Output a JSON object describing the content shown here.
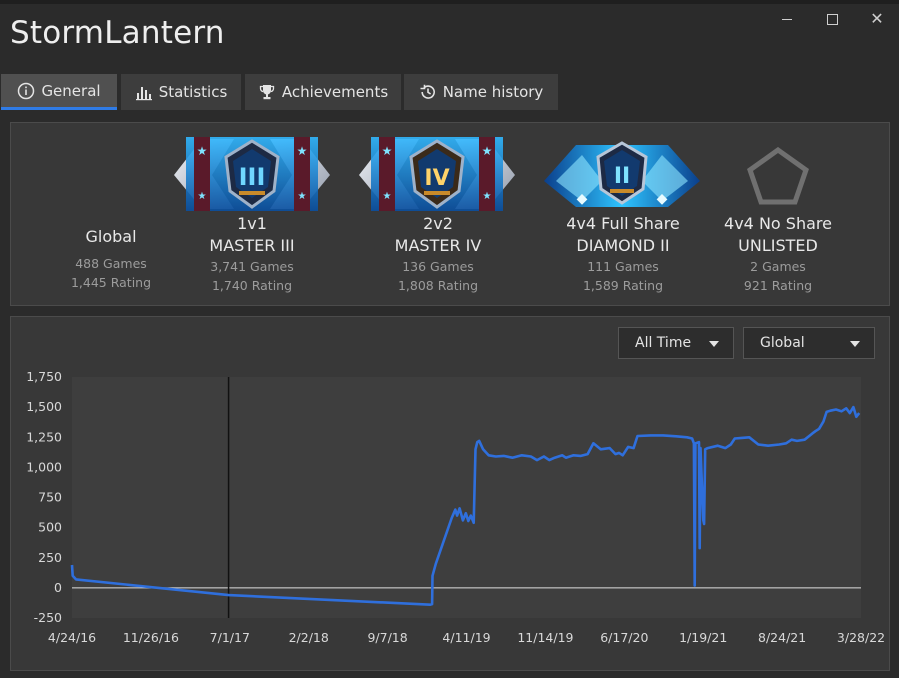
{
  "window": {
    "title": "StormLantern"
  },
  "tabs": [
    {
      "label": "General",
      "icon": "info-icon",
      "active": true
    },
    {
      "label": "Statistics",
      "icon": "bar-chart-icon",
      "active": false
    },
    {
      "label": "Achievements",
      "icon": "trophy-icon",
      "active": false
    },
    {
      "label": "Name history",
      "icon": "history-icon",
      "active": false
    }
  ],
  "ranks": [
    {
      "mode": "Global",
      "tier": "",
      "games": "488 Games",
      "rating": "1,445 Rating",
      "badge": "none"
    },
    {
      "mode": "1v1",
      "tier": "MASTER III",
      "games": "3,741 Games",
      "rating": "1,740 Rating",
      "badge": "master-badge-icon",
      "numeral": "III"
    },
    {
      "mode": "2v2",
      "tier": "MASTER IV",
      "games": "136 Games",
      "rating": "1,808 Rating",
      "badge": "master-badge-icon",
      "numeral": "IV"
    },
    {
      "mode": "4v4 Full Share",
      "tier": "DIAMOND II",
      "games": "111 Games",
      "rating": "1,589 Rating",
      "badge": "diamond-badge-icon",
      "numeral": "II"
    },
    {
      "mode": "4v4 No Share",
      "tier": "UNLISTED",
      "games": "2 Games",
      "rating": "921 Rating",
      "badge": "unlisted-badge-icon"
    }
  ],
  "filters": {
    "time_range": "All Time",
    "leaderboard": "Global"
  },
  "colors": {
    "accent": "#2f7be6",
    "series": "#2f6fdc",
    "background": "#2b2b2b",
    "plot_area": "#383838"
  },
  "chart_data": {
    "type": "line",
    "ylim": [
      -250,
      1750
    ],
    "yticks": [
      "1,750",
      "1,500",
      "1,250",
      "1,000",
      "750",
      "500",
      "250",
      "0",
      "-250"
    ],
    "xticks": [
      "4/24/16",
      "11/26/16",
      "7/1/17",
      "2/2/18",
      "9/7/18",
      "4/11/19",
      "11/14/19",
      "6/17/20",
      "1/19/21",
      "8/24/21",
      "3/28/22"
    ],
    "xlim": [
      "2016-04-24",
      "2022-04-15"
    ],
    "zero_line": true,
    "marker_date": "2017-07-01",
    "series": [
      {
        "points": [
          [
            "2016-04-24",
            190
          ],
          [
            "2016-04-26",
            100
          ],
          [
            "2016-05-05",
            70
          ],
          [
            "2017-07-01",
            -60
          ],
          [
            "2019-01-10",
            -140
          ],
          [
            "2019-01-15",
            -135
          ],
          [
            "2019-01-16",
            100
          ],
          [
            "2019-01-25",
            200
          ],
          [
            "2019-03-10",
            580
          ],
          [
            "2019-03-20",
            650
          ],
          [
            "2019-03-25",
            600
          ],
          [
            "2019-04-01",
            660
          ],
          [
            "2019-04-10",
            560
          ],
          [
            "2019-04-18",
            620
          ],
          [
            "2019-04-25",
            555
          ],
          [
            "2019-05-02",
            600
          ],
          [
            "2019-05-10",
            540
          ],
          [
            "2019-05-15",
            1150
          ],
          [
            "2019-05-20",
            1210
          ],
          [
            "2019-05-25",
            1220
          ],
          [
            "2019-06-05",
            1150
          ],
          [
            "2019-06-20",
            1100
          ],
          [
            "2019-07-10",
            1090
          ],
          [
            "2019-08-01",
            1095
          ],
          [
            "2019-08-25",
            1080
          ],
          [
            "2019-09-20",
            1100
          ],
          [
            "2019-10-15",
            1090
          ],
          [
            "2019-11-01",
            1060
          ],
          [
            "2019-11-20",
            1090
          ],
          [
            "2019-12-05",
            1060
          ],
          [
            "2019-12-20",
            1080
          ],
          [
            "2020-01-10",
            1100
          ],
          [
            "2020-01-20",
            1080
          ],
          [
            "2020-02-10",
            1100
          ],
          [
            "2020-03-01",
            1095
          ],
          [
            "2020-03-20",
            1110
          ],
          [
            "2020-04-05",
            1200
          ],
          [
            "2020-04-25",
            1150
          ],
          [
            "2020-05-20",
            1160
          ],
          [
            "2020-06-05",
            1110
          ],
          [
            "2020-06-15",
            1120
          ],
          [
            "2020-06-25",
            1100
          ],
          [
            "2020-07-10",
            1170
          ],
          [
            "2020-07-25",
            1160
          ],
          [
            "2020-08-05",
            1260
          ],
          [
            "2020-09-10",
            1265
          ],
          [
            "2020-10-15",
            1265
          ],
          [
            "2020-11-20",
            1258
          ],
          [
            "2020-12-20",
            1250
          ],
          [
            "2021-01-03",
            1240
          ],
          [
            "2021-01-08",
            1200
          ],
          [
            "2021-01-10",
            20
          ],
          [
            "2021-01-12",
            1200
          ],
          [
            "2021-01-22",
            1210
          ],
          [
            "2021-01-24",
            330
          ],
          [
            "2021-01-26",
            1160
          ],
          [
            "2021-02-03",
            560
          ],
          [
            "2021-02-05",
            530
          ],
          [
            "2021-02-08",
            1150
          ],
          [
            "2021-02-15",
            1160
          ],
          [
            "2021-03-15",
            1180
          ],
          [
            "2021-04-05",
            1160
          ],
          [
            "2021-04-20",
            1190
          ],
          [
            "2021-05-01",
            1240
          ],
          [
            "2021-05-20",
            1245
          ],
          [
            "2021-06-10",
            1250
          ],
          [
            "2021-07-05",
            1190
          ],
          [
            "2021-08-01",
            1180
          ],
          [
            "2021-09-01",
            1190
          ],
          [
            "2021-09-20",
            1200
          ],
          [
            "2021-10-05",
            1230
          ],
          [
            "2021-10-20",
            1220
          ],
          [
            "2021-11-10",
            1230
          ],
          [
            "2021-12-01",
            1280
          ],
          [
            "2021-12-10",
            1300
          ],
          [
            "2021-12-20",
            1320
          ],
          [
            "2022-01-01",
            1380
          ],
          [
            "2022-01-10",
            1460
          ],
          [
            "2022-01-20",
            1470
          ],
          [
            "2022-02-05",
            1480
          ],
          [
            "2022-02-20",
            1465
          ],
          [
            "2022-03-05",
            1490
          ],
          [
            "2022-03-15",
            1450
          ],
          [
            "2022-03-25",
            1500
          ],
          [
            "2022-04-02",
            1420
          ],
          [
            "2022-04-10",
            1450
          ]
        ]
      }
    ]
  }
}
